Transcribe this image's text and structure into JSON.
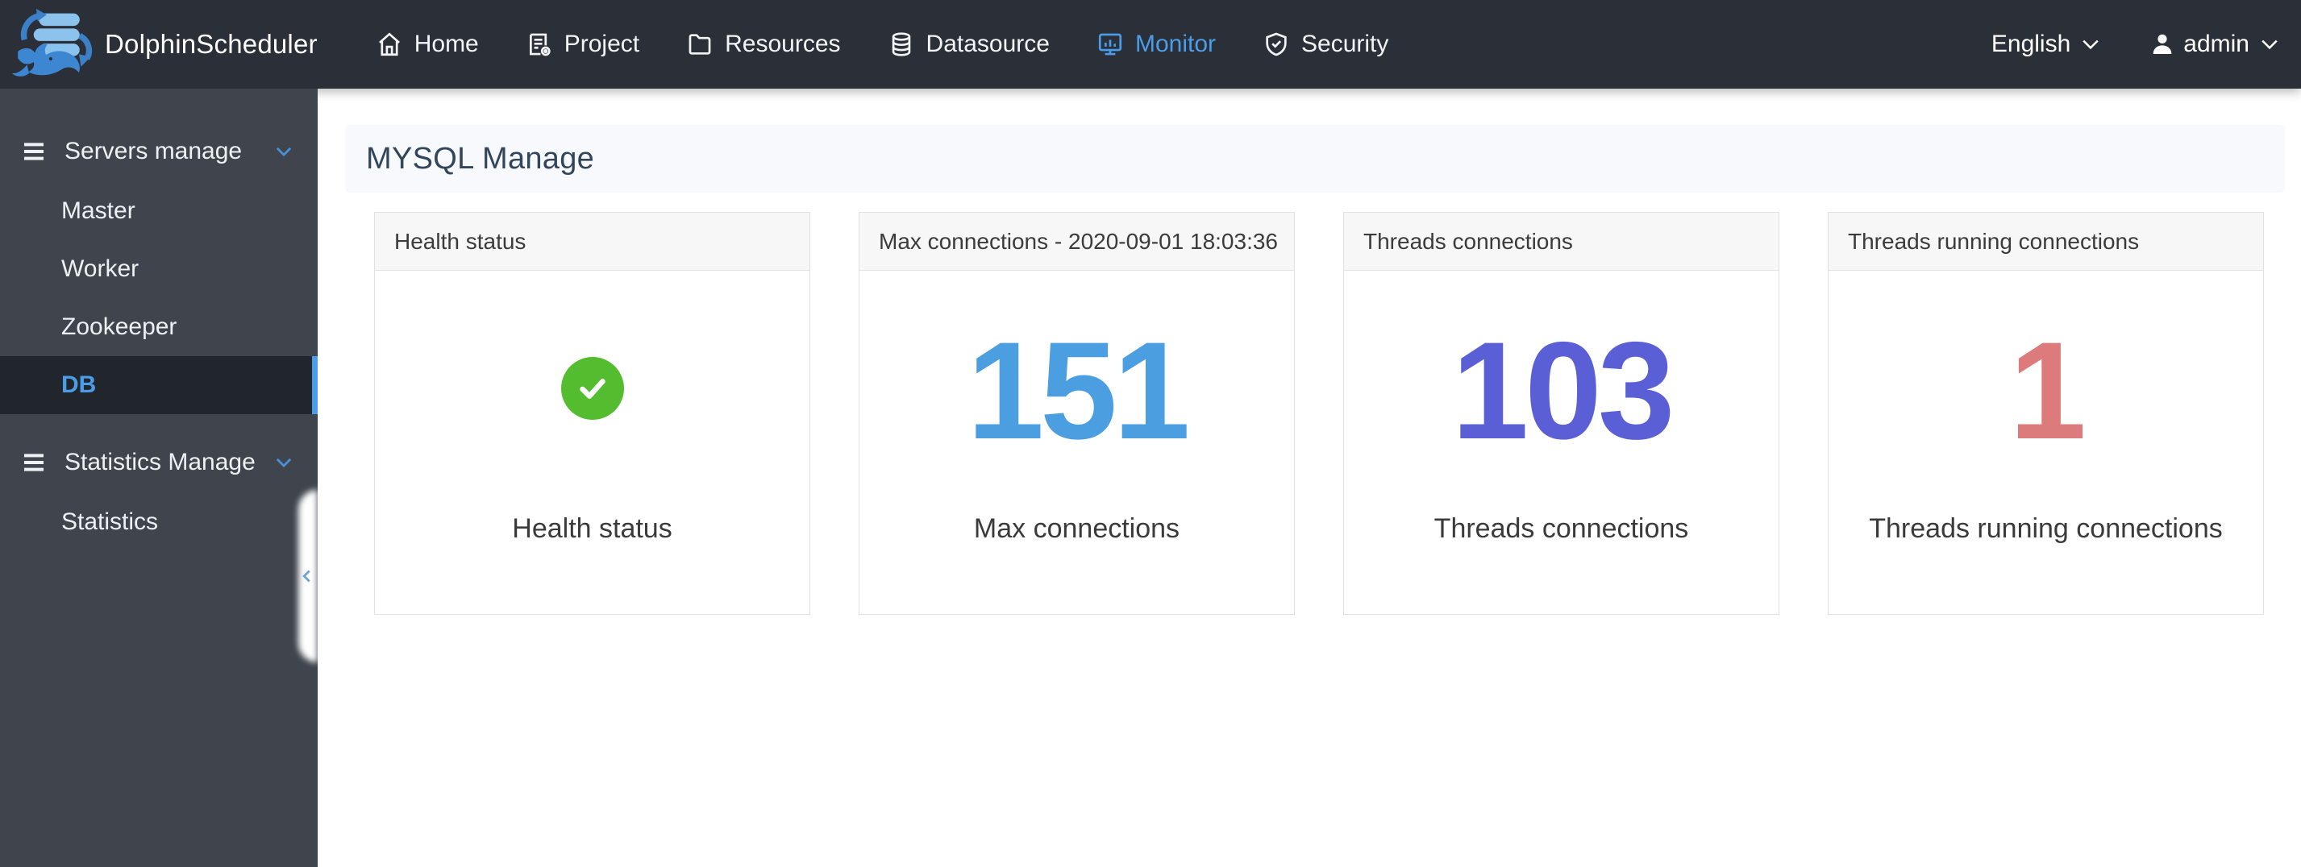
{
  "brand": {
    "name": "DolphinScheduler",
    "logo": "dolphin-logo"
  },
  "topnav": {
    "items": [
      {
        "label": "Home",
        "icon": "home-icon",
        "active": false
      },
      {
        "label": "Project",
        "icon": "project-icon",
        "active": false
      },
      {
        "label": "Resources",
        "icon": "resources-icon",
        "active": false
      },
      {
        "label": "Datasource",
        "icon": "datasource-icon",
        "active": false
      },
      {
        "label": "Monitor",
        "icon": "monitor-icon",
        "active": true
      },
      {
        "label": "Security",
        "icon": "security-icon",
        "active": false
      }
    ],
    "language": {
      "label": "English",
      "icon": "chevron-down-icon"
    },
    "user": {
      "name": "admin",
      "icon": "user-icon",
      "chevron": "chevron-down-icon"
    }
  },
  "sidebar": {
    "groups": [
      {
        "label": "Servers manage",
        "icon": "menu-icon",
        "chevron": "chevron-down-icon",
        "items": [
          {
            "label": "Master",
            "active": false
          },
          {
            "label": "Worker",
            "active": false
          },
          {
            "label": "Zookeeper",
            "active": false
          },
          {
            "label": "DB",
            "active": true
          }
        ]
      },
      {
        "label": "Statistics Manage",
        "icon": "menu-icon",
        "chevron": "chevron-down-icon",
        "items": [
          {
            "label": "Statistics",
            "active": false
          }
        ]
      }
    ],
    "collapse_handle_icon": "chevron-left-icon"
  },
  "page": {
    "title": "MYSQL Manage"
  },
  "cards": [
    {
      "header": "Health status",
      "kind": "status",
      "label": "Health status",
      "status_icon": "check-circle-icon",
      "status_color": "#54bd2f"
    },
    {
      "header": "Max connections - 2020-09-01 18:03:36",
      "kind": "metric",
      "value": "151",
      "label": "Max connections",
      "value_color": "#4b9fe0"
    },
    {
      "header": "Threads connections",
      "kind": "metric",
      "value": "103",
      "label": "Threads connections",
      "value_color": "#5a5fd6"
    },
    {
      "header": "Threads running connections",
      "kind": "metric",
      "value": "1",
      "label": "Threads running connections",
      "value_color": "#dd7a7b"
    }
  ],
  "colors": {
    "accent_blue": "#4a9de9",
    "topnav_bg": "#2a2f38",
    "sidebar_bg": "#3f444d",
    "active_item_bg": "#21262d",
    "title_bar_bg": "#f8f9fd",
    "card_header_bg": "#f7f7f7"
  }
}
